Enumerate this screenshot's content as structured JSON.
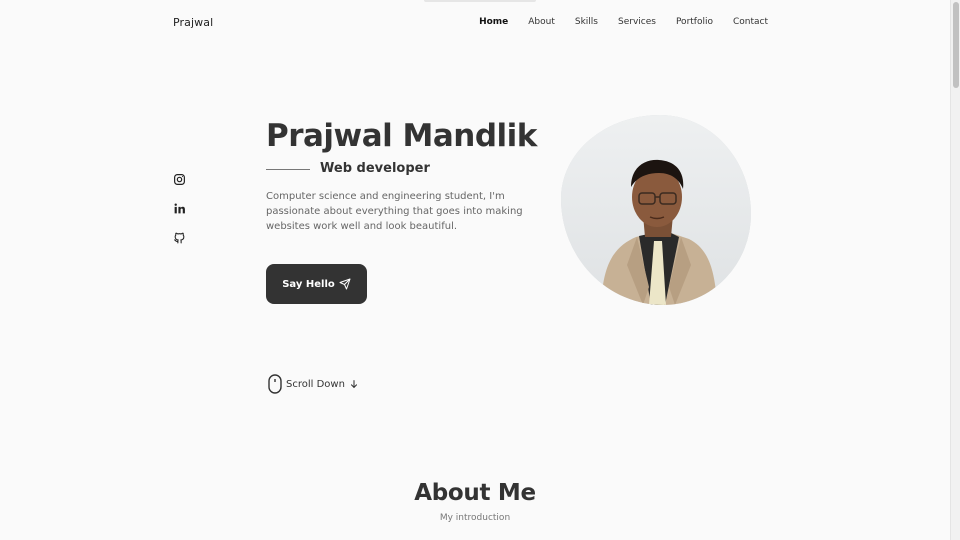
{
  "header": {
    "logo": "Prajwal",
    "nav": [
      "Home",
      "About",
      "Skills",
      "Services",
      "Portfolio",
      "Contact"
    ],
    "active_nav": "Home"
  },
  "socials": [
    "instagram-icon",
    "linkedin-icon",
    "github-icon"
  ],
  "hero": {
    "name": "Prajwal Mandlik",
    "role": "Web developer",
    "description": "Computer science and engineering student, I'm passionate about everything that goes into making websites work well and look beautiful.",
    "cta_label": "Say Hello"
  },
  "scroll": {
    "label": "Scroll Down"
  },
  "about": {
    "title": "About Me",
    "subtitle": "My introduction"
  },
  "colors": {
    "accent": "#333333",
    "background": "#fafafa"
  }
}
